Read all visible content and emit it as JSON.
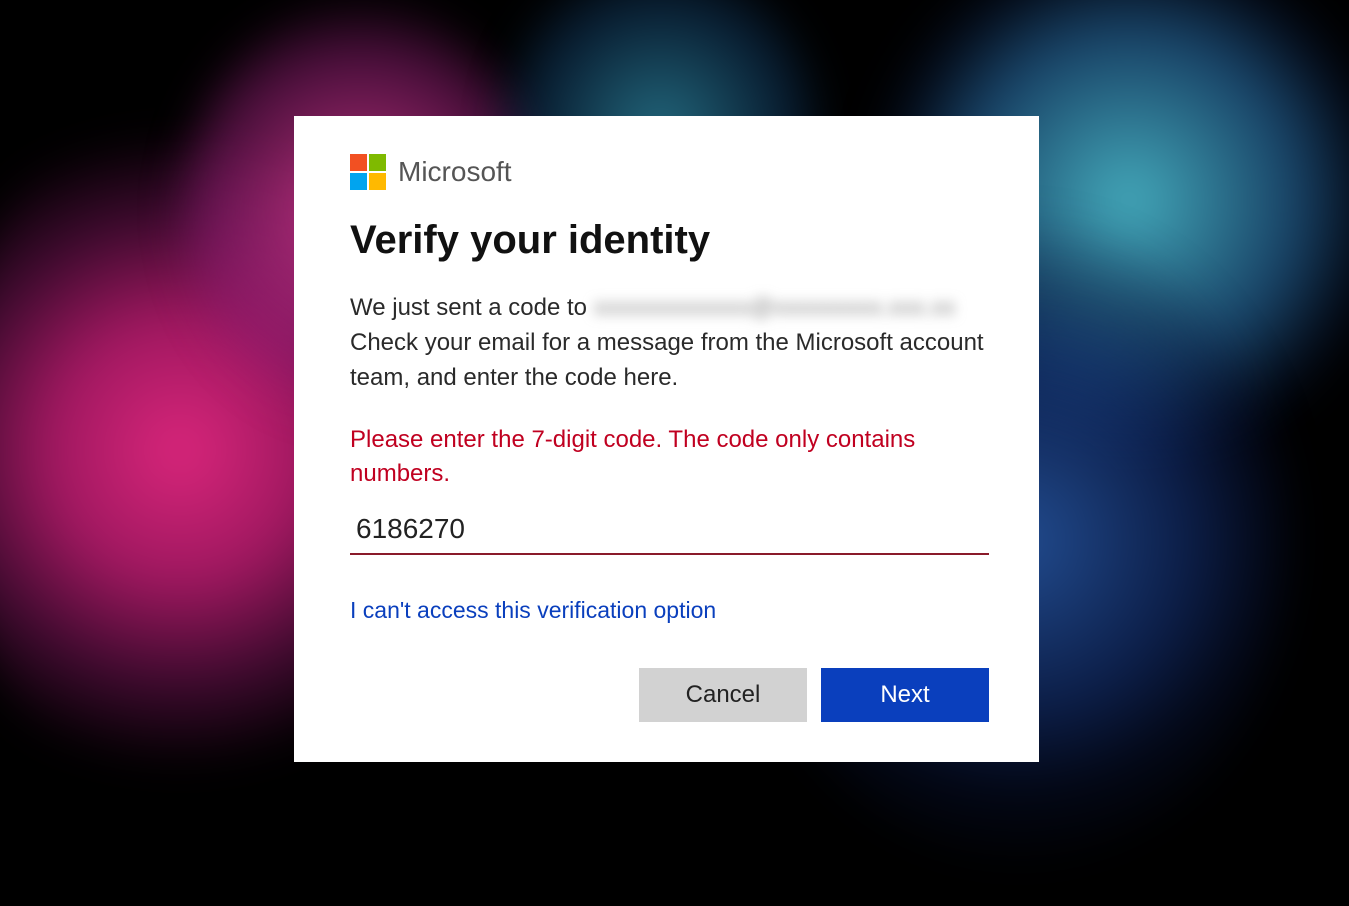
{
  "brand": {
    "name": "Microsoft",
    "logo_colors": [
      "#f25022",
      "#7fba00",
      "#00a4ef",
      "#ffb900"
    ]
  },
  "dialog": {
    "heading": "Verify your identity",
    "info_prefix": "We just sent a code to ",
    "info_email_masked": "xxxxxxxxxxxxx@xxxxxxxxx.xxx.xx",
    "info_suffix": "Check your email for a message from the Microsoft account team, and enter the code here.",
    "error": "Please enter the 7-digit code. The code only contains numbers.",
    "code_value": "6186270",
    "alt_link": "I can't access this verification option",
    "buttons": {
      "cancel": "Cancel",
      "next": "Next"
    }
  },
  "colors": {
    "error": "#c00020",
    "link": "#0a3fbd",
    "primary_button": "#0a3fbd",
    "secondary_button": "#d2d2d2"
  }
}
